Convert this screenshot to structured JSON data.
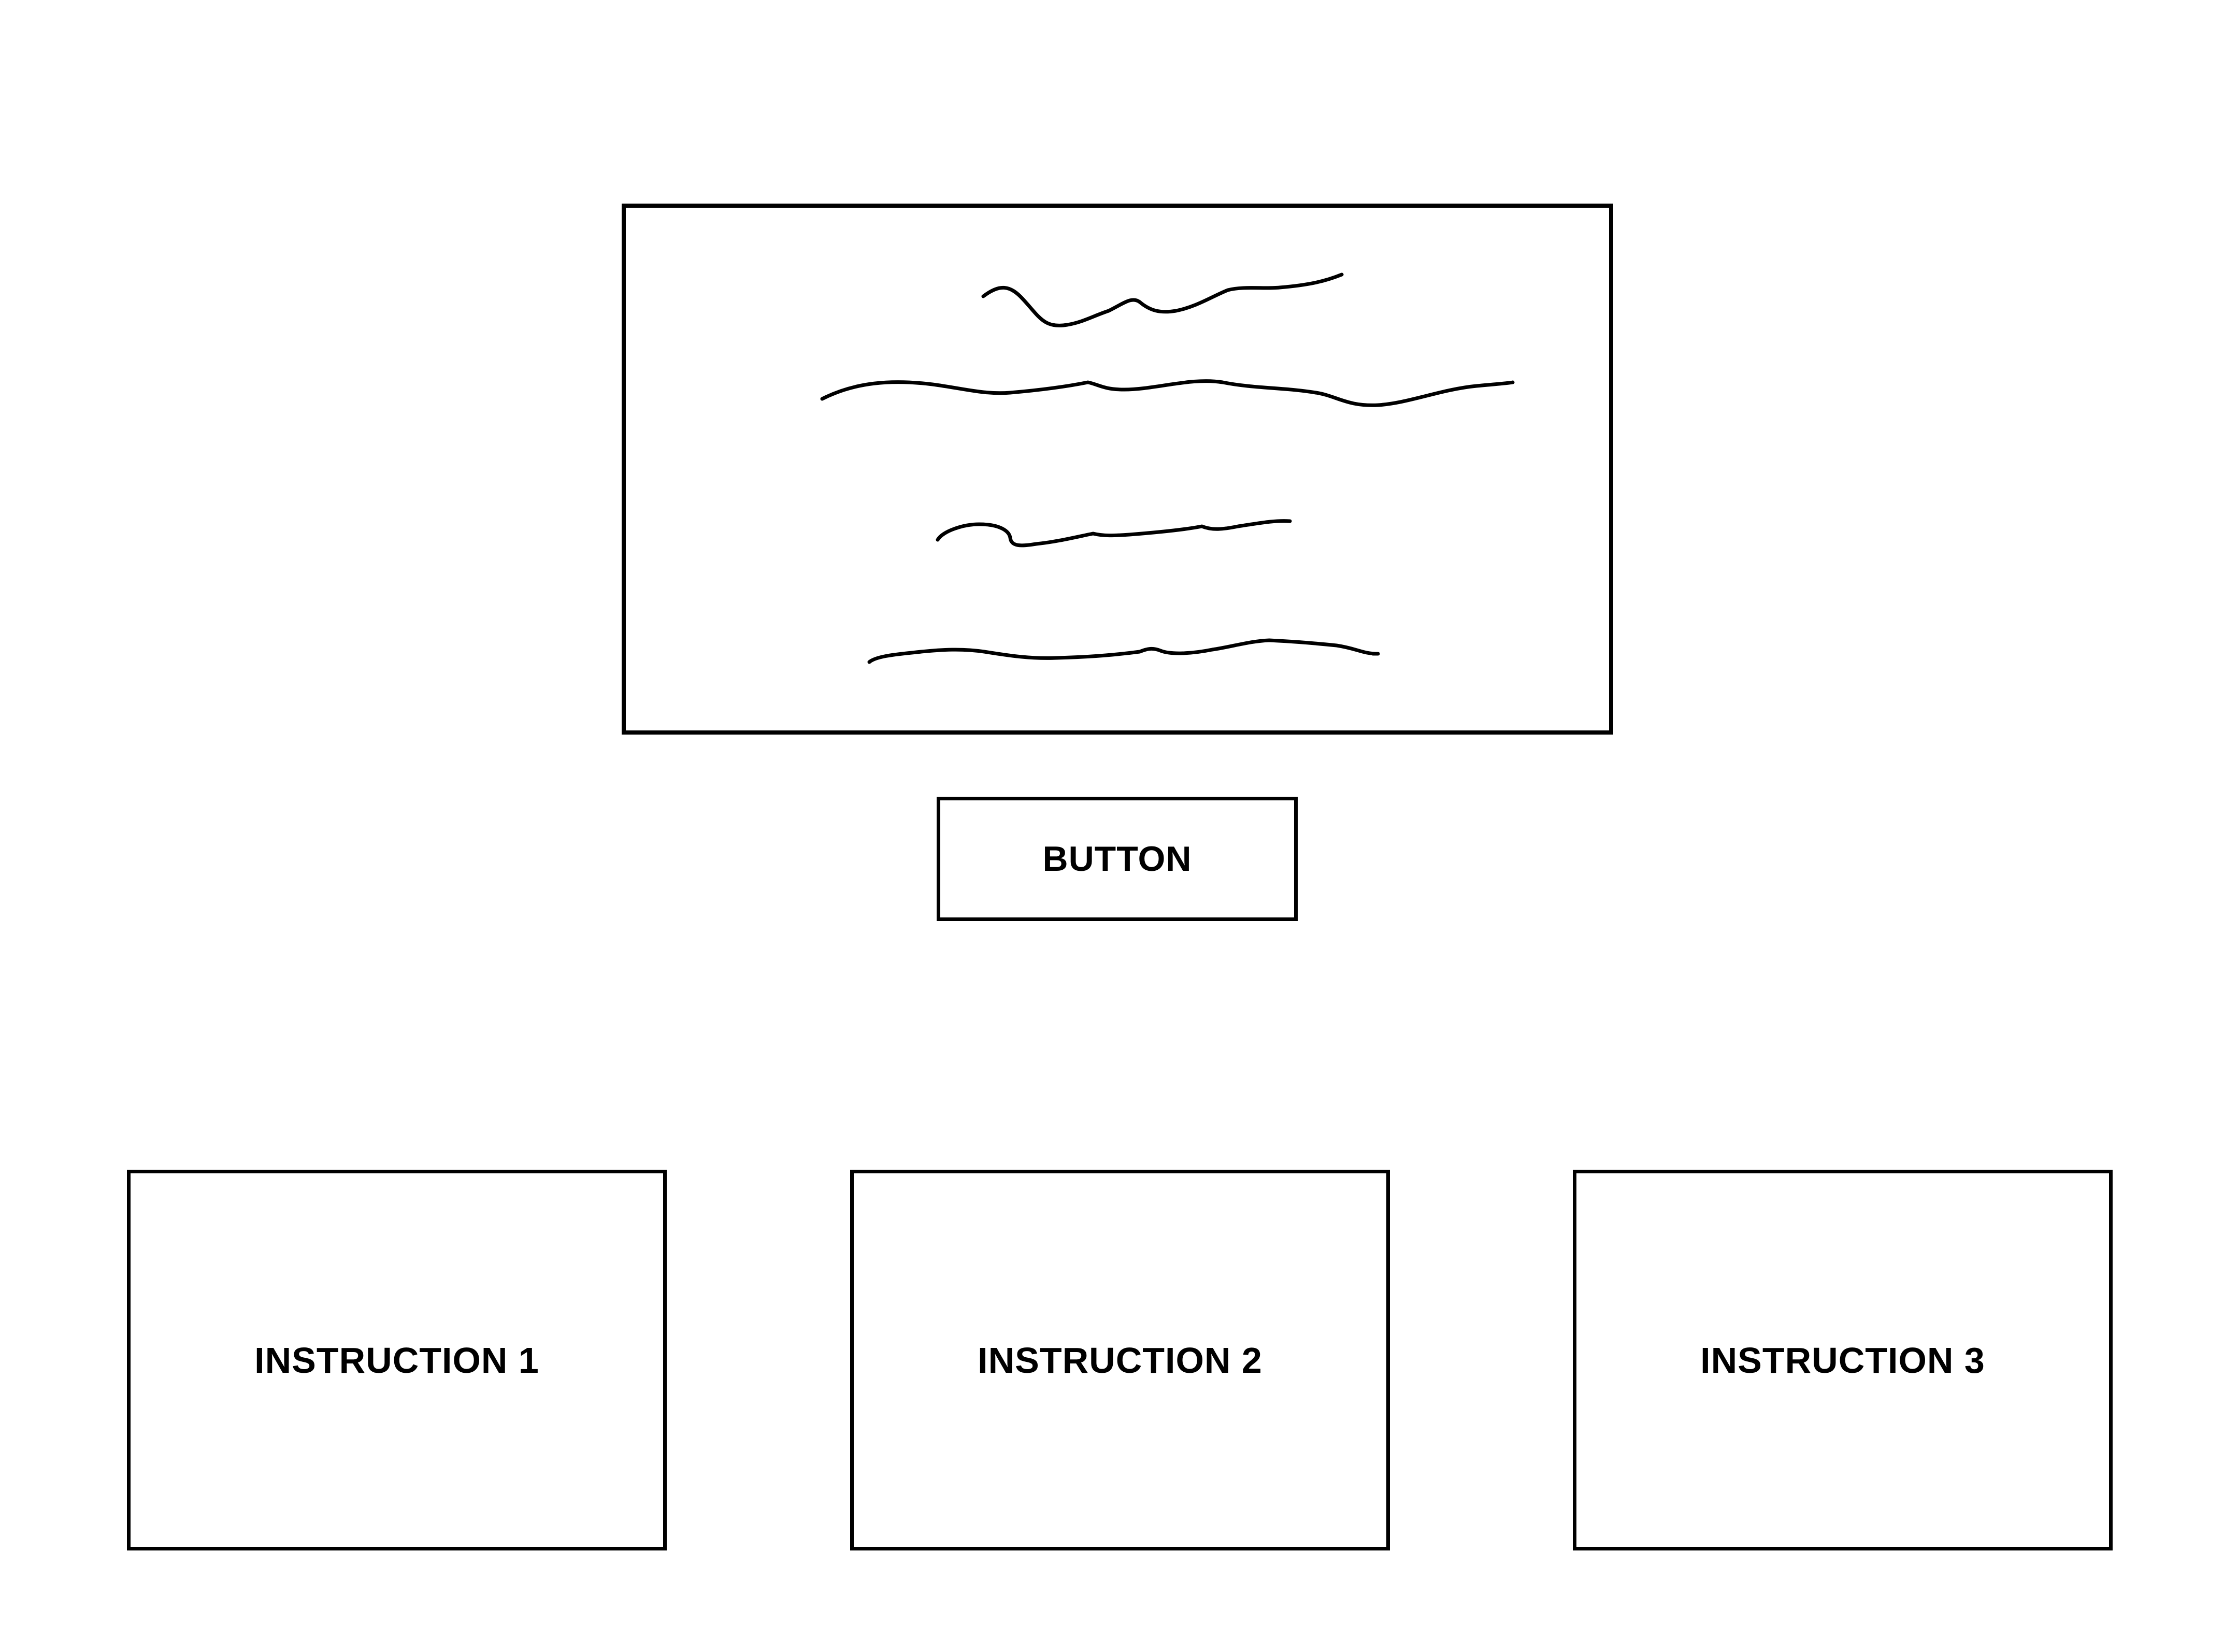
{
  "hero": {
    "text_lines_placeholder": 4
  },
  "primary_button": {
    "label": "BUTTON"
  },
  "instructions": [
    {
      "label": "INSTRUCTION 1"
    },
    {
      "label": "INSTRUCTION 2"
    },
    {
      "label": "INSTRUCTION 3"
    }
  ],
  "colors": {
    "stroke": "#000000",
    "background": "#ffffff"
  }
}
